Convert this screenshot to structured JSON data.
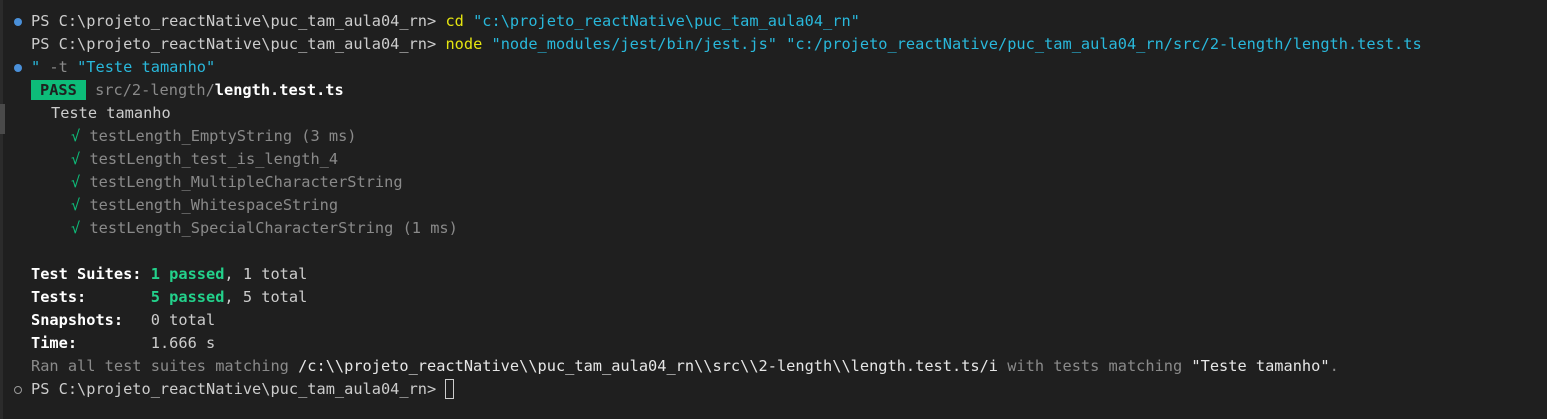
{
  "terminal": {
    "cmd1": {
      "prompt": "PS C:\\projeto_reactNative\\puc_tam_aula04_rn> ",
      "command": "cd",
      "arg": " \"c:\\projeto_reactNative\\puc_tam_aula04_rn\""
    },
    "cmd2": {
      "prompt": "PS C:\\projeto_reactNative\\puc_tam_aula04_rn> ",
      "command": "node",
      "arg": " \"node_modules/jest/bin/jest.js\" \"c:/projeto_reactNative/puc_tam_aula04_rn/src/2-length/length.test.ts",
      "continuation_quote": "\"",
      "continuation_flag": " -t ",
      "continuation_arg": "\"Teste tamanho\""
    },
    "result": {
      "badge": "PASS",
      "path_dir": "src/2-length/",
      "path_file": "length.test.ts",
      "describe": "Teste tamanho",
      "tests": [
        {
          "check": "√",
          "name": "testLength_EmptyString",
          "time": " (3 ms)"
        },
        {
          "check": "√",
          "name": "testLength_test_is_length_4",
          "time": ""
        },
        {
          "check": "√",
          "name": "testLength_MultipleCharacterString",
          "time": ""
        },
        {
          "check": "√",
          "name": "testLength_WhitespaceString",
          "time": ""
        },
        {
          "check": "√",
          "name": "testLength_SpecialCharacterString",
          "time": " (1 ms)"
        }
      ]
    },
    "summary": {
      "suites_label": "Test Suites: ",
      "suites_passed": "1 passed",
      "suites_total": ", 1 total",
      "tests_label": "Tests:       ",
      "tests_passed": "5 passed",
      "tests_total": ", 5 total",
      "snapshots_label": "Snapshots:   ",
      "snapshots_value": "0 total",
      "time_label": "Time:        ",
      "time_value": "1.666 s",
      "ran_prefix": "Ran all test suites matching ",
      "ran_pattern": "/c:\\\\projeto_reactNative\\\\puc_tam_aula04_rn\\\\src\\\\2-length\\\\length.test.ts/i",
      "ran_middle": " with tests matching ",
      "ran_name": "\"Teste tamanho\"",
      "ran_end": "."
    },
    "final_prompt": "PS C:\\projeto_reactNative\\puc_tam_aula04_rn> "
  }
}
